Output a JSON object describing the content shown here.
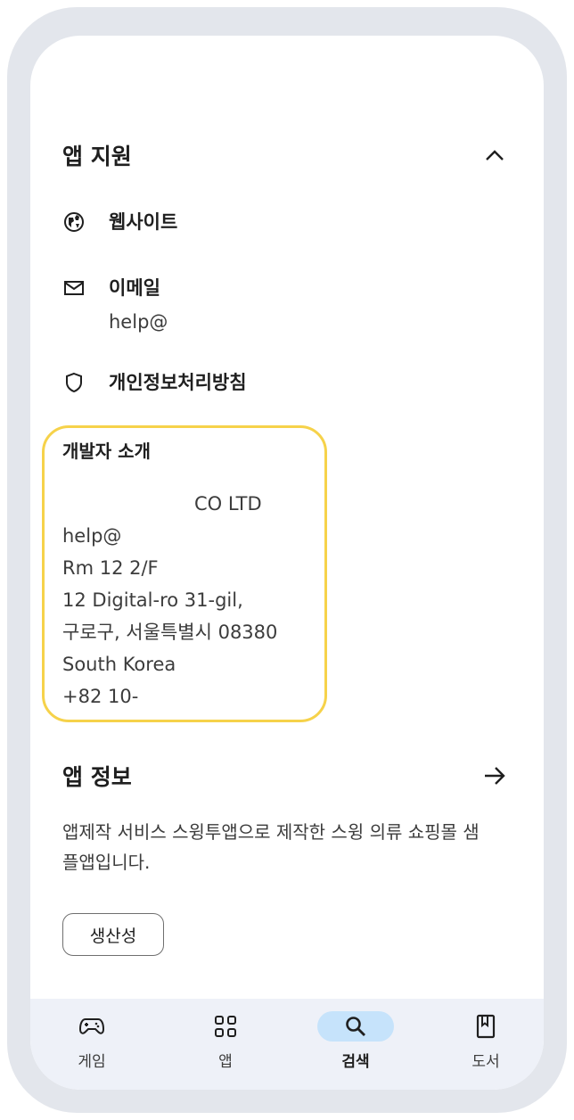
{
  "app_support": {
    "title": "앱 지원",
    "items": [
      {
        "label": "웹사이트",
        "icon": "globe-icon"
      },
      {
        "label": "이메일",
        "value": "help@",
        "icon": "mail-icon"
      },
      {
        "label": "개인정보처리방침",
        "icon": "shield-icon"
      }
    ]
  },
  "developer": {
    "title": "개발자 소개",
    "company": "CO LTD",
    "email": "help@",
    "address_line1": "Rm 12 2/F",
    "address_line2": "12 Digital-ro 31-gil,",
    "address_line3": "구로구, 서울특별시 08380",
    "country": "South Korea",
    "phone": "+82 10-",
    "highlight_color": "#f6d24a"
  },
  "app_info": {
    "title": "앱 정보",
    "description": "앱제작 서비스 스윙투앱으로 제작한 스윙 의류 쇼핑몰 샘플앱입니다.",
    "category_chip": "생산성"
  },
  "bottom_nav": {
    "items": [
      {
        "label": "게임",
        "icon": "gamepad-icon",
        "active": false
      },
      {
        "label": "앱",
        "icon": "apps-grid-icon",
        "active": false
      },
      {
        "label": "검색",
        "icon": "search-icon",
        "active": true
      },
      {
        "label": "도서",
        "icon": "book-icon",
        "active": false
      }
    ],
    "active_color": "#c6e3fb"
  }
}
